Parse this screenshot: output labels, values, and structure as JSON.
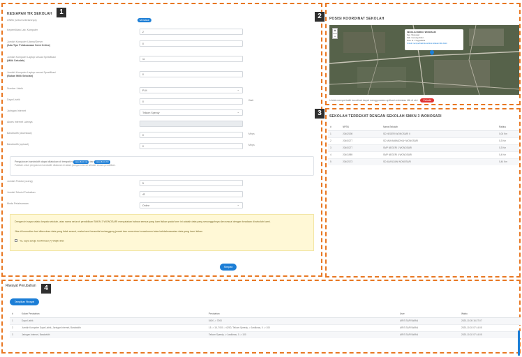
{
  "badges": [
    "1",
    "2",
    "3",
    "3",
    "4"
  ],
  "form": {
    "title": "KESIAPAN TIK SEKOLAH",
    "npsn_label": "UNBK (sebut sebelumnya)",
    "npsn_value": "Memadai",
    "rows": [
      {
        "label": "Kepemilikan Lab. Komputer",
        "value": "2",
        "type": "input"
      },
      {
        "label": "Jumlah Komputer Utama/Server",
        "sub": "(Ada Tipe Pelaksanaan Semi Online)",
        "value": "0",
        "type": "input"
      },
      {
        "label": "Jumlah Komputer Laptop sesuai Spesifikasi",
        "sub": "(Milik Sekolah)",
        "value": "11",
        "type": "input"
      },
      {
        "label": "Jumlah Komputer Laptop sesuai Spesifikasi",
        "sub": "(Bukan Milik Sekolah)",
        "value": "0",
        "type": "input"
      },
      {
        "label": "Sumber Listrik",
        "value": "PLN",
        "type": "select"
      },
      {
        "label": "Daya Listrik",
        "value": "0",
        "type": "input",
        "unit": "Watt"
      },
      {
        "label": "Jaringan Internet",
        "value": "Telkom Speedy",
        "type": "select"
      },
      {
        "label": "Akses Internet Lainnya",
        "value": "",
        "type": "disabled"
      },
      {
        "label": "Bandwidth (download)",
        "value": "0",
        "type": "input",
        "unit": "Mbps"
      },
      {
        "label": "Bandwidth (upload)",
        "value": "0",
        "type": "input",
        "unit": "Mbps"
      }
    ],
    "info_line1_pre": "Pengukuran bandwidth dapat dilakukan di tempat ini",
    "info_chip1": "speedtest.net",
    "info_mid": "dan",
    "info_chip2": "speedtest.cbn",
    "info_line2": "Pastikan untuk pengukuran bandwidth dilakukan di dalam jaringan internet sekolah secara pendidikan.",
    "rows2": [
      {
        "label": "Jumlah Proktor (orang)",
        "value": "5",
        "type": "input"
      },
      {
        "label": "Jumlah Teknisi Perbaikan",
        "value": "42",
        "type": "input"
      },
      {
        "label": "Moda Pelaksanaan",
        "value": "Online",
        "type": "select"
      }
    ],
    "notice_1": "Dengan ini saya selaku kepala sekolah, atas nama seluruh pendidikan SMKN 3 WONOSARI menyatakan bahwa semua yang kami isikan pada form ini adalah data yang sesungguhnya dan sesuai dengan keadaan di sekolah kami.",
    "notice_2": "Jika di kemudian hari ditemukan data yang tidak sesuai, maka kami bersedia bertanggung jawab dan menerima konsekuensi atas ketidaksesuaian data yang kami isikan.",
    "notice_check": "Ya, saya setuju konfirmasi (*) Wajib diisi",
    "save_label": "Simpan"
  },
  "map": {
    "title": "POSISI KOORDINAT SEKOLAH",
    "zoom_in": "+",
    "zoom_out": "−",
    "popup_title": "SEKOLAH SMKN 3 WONOSARI",
    "popup_lines": [
      "Kec. Wonosari",
      "Kab. Gunung Kidul",
      "Prov. D.I. Yogyakarta",
      "Untuk memperbaiki koordinat silakan klik disini"
    ],
    "note": "Untuk memperbaiki koordinat dapat menggunakan aplikasi emis/atau klik di sini",
    "note_button": "Perbaiki"
  },
  "nearby": {
    "title": "SEKOLAH TERDEKAT DENGAN SEKOLAH SMKN 3 WONOSARI",
    "headers": [
      "#",
      "NPSN",
      "Nama Sekolah",
      "Radius"
    ],
    "rows": [
      [
        "1",
        "20402198",
        "SD NEGERI WONOSARI II",
        "0,04 Km"
      ],
      [
        "2",
        "20400277",
        "SD MUHAMMADIYAH WONOSARI",
        "0,3 Km"
      ],
      [
        "3",
        "20400277",
        "SMP NEGERI 1 WONOSARI",
        "0,3 Km"
      ],
      [
        "4",
        "20401989",
        "SMP NEGERI 4 WONOSARI",
        "0,4 Km"
      ],
      [
        "5",
        "20402173",
        "SD ALWILDAN WONOSARI",
        "0,44 Km"
      ]
    ]
  },
  "history": {
    "title": "Riwayat Perubahan",
    "button": "Tampilkan Riwayat",
    "headers": [
      "#",
      "Kolom Perubahan",
      "Perubahan",
      "User",
      "Waktu"
    ],
    "rows": [
      [
        "1",
        "Daya Listrik",
        "5400 -> 7000",
        "ARIS SARYAWAN",
        "2020-10-05 16:27:07"
      ],
      [
        "2",
        "Jumlah Komputer Daya Listrik, Jaringan Internet, Bandwidth",
        "15 -> 15, 7000 -> 6200, Telkom Speedy -> Jardiknas, 0 -> 100",
        "ARIS SARYAWAN",
        "2020-10-03 07:14:05"
      ],
      [
        "3",
        "Jaringan Internet, Bandwidth",
        "Telkom Speedy -> Jardiknas, 0 -> 100",
        "ARIS SARYAWAN",
        "2020-10-02 07:14:05"
      ]
    ]
  }
}
